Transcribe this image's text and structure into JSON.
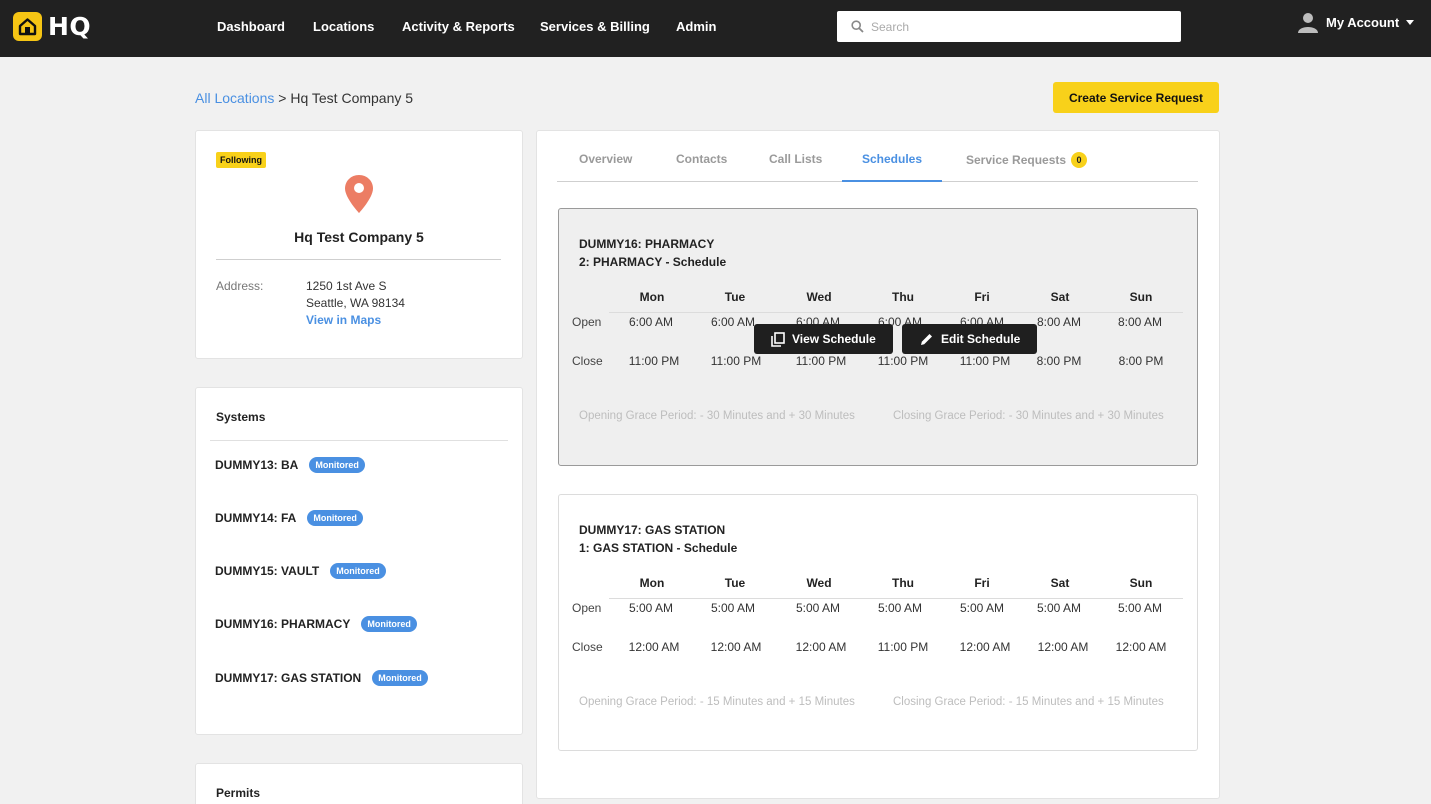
{
  "app": {
    "logo_text": "HQ"
  },
  "nav": {
    "items": [
      {
        "label": "Dashboard"
      },
      {
        "label": "Locations"
      },
      {
        "label": "Activity & Reports"
      },
      {
        "label": "Services & Billing"
      },
      {
        "label": "Admin"
      }
    ],
    "search_placeholder": "Search",
    "account_label": "My Account"
  },
  "breadcrumb": {
    "root": "All Locations",
    "separator": " > ",
    "current": "Hq Test Company 5"
  },
  "cta_label": "Create Service Request",
  "location": {
    "badge": "Following",
    "name": "Hq Test Company 5",
    "address_label": "Address:",
    "address_line1": "1250 1st Ave S",
    "address_line2": "Seattle, WA 98134",
    "maps_link": "View in Maps"
  },
  "systems": {
    "title": "Systems",
    "items": [
      {
        "name": "DUMMY13: BA",
        "status": "Monitored"
      },
      {
        "name": "DUMMY14: FA",
        "status": "Monitored"
      },
      {
        "name": "DUMMY15: VAULT",
        "status": "Monitored"
      },
      {
        "name": "DUMMY16: PHARMACY",
        "status": "Monitored"
      },
      {
        "name": "DUMMY17: GAS STATION",
        "status": "Monitored"
      }
    ]
  },
  "permits": {
    "title": "Permits"
  },
  "tabs": {
    "items": [
      {
        "label": "Overview"
      },
      {
        "label": "Contacts"
      },
      {
        "label": "Call Lists"
      },
      {
        "label": "Schedules"
      },
      {
        "label": "Service Requests",
        "count": "0"
      }
    ],
    "active": "Schedules"
  },
  "days": [
    "Mon",
    "Tue",
    "Wed",
    "Thu",
    "Fri",
    "Sat",
    "Sun"
  ],
  "row_labels": {
    "open": "Open",
    "close": "Close"
  },
  "actions": {
    "view": "View Schedule",
    "edit": "Edit Schedule"
  },
  "schedules": [
    {
      "system": "DUMMY16: PHARMACY",
      "schedule": "2: PHARMACY - Schedule",
      "open": [
        "6:00 AM",
        "6:00 AM",
        "6:00 AM",
        "6:00 AM",
        "6:00 AM",
        "8:00 AM",
        "8:00 AM"
      ],
      "close": [
        "11:00 PM",
        "11:00 PM",
        "11:00 PM",
        "11:00 PM",
        "11:00 PM",
        "8:00 PM",
        "8:00 PM"
      ],
      "opening_grace": "Opening Grace Period: - 30 Minutes and + 30 Minutes",
      "closing_grace": "Closing Grace Period: - 30 Minutes and + 30 Minutes"
    },
    {
      "system": "DUMMY17: GAS STATION",
      "schedule": "1: GAS STATION - Schedule",
      "open": [
        "5:00 AM",
        "5:00 AM",
        "5:00 AM",
        "5:00 AM",
        "5:00 AM",
        "5:00 AM",
        "5:00 AM"
      ],
      "close": [
        "12:00 AM",
        "12:00 AM",
        "12:00 AM",
        "11:00 PM",
        "12:00 AM",
        "12:00 AM",
        "12:00 AM"
      ],
      "opening_grace": "Opening Grace Period: - 15 Minutes and + 15 Minutes",
      "closing_grace": "Closing Grace Period: - 15 Minutes and + 15 Minutes"
    }
  ],
  "colors": {
    "brand_yellow": "#f8d11a",
    "accent_blue": "#4a90e2",
    "topbar": "#212121",
    "pin": "#ec7d64"
  }
}
